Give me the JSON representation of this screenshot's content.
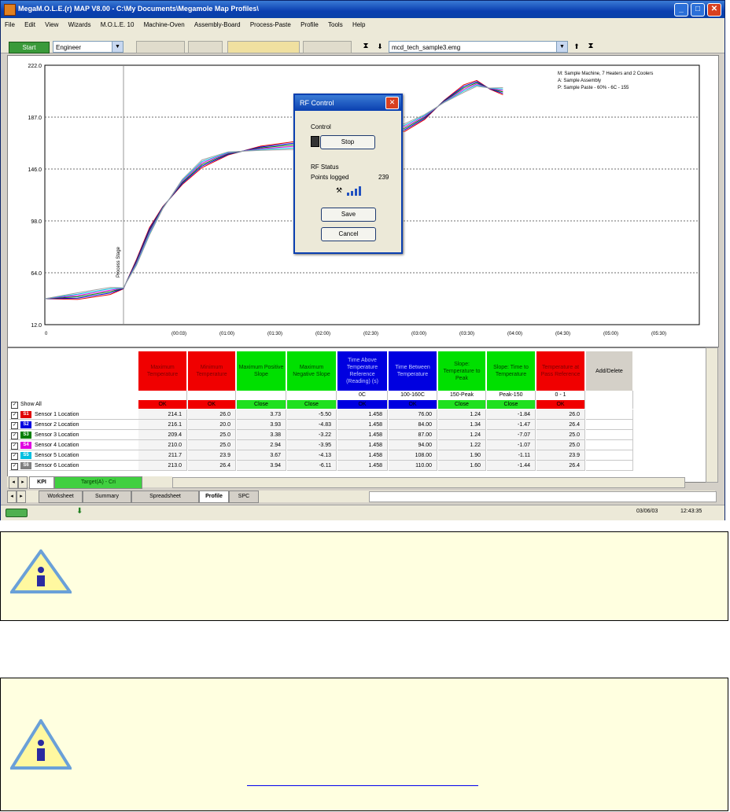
{
  "window": {
    "title": "MegaM.O.L.E.(r) MAP V8.00 - C:\\My Documents\\Megamole Map Profiles\\",
    "minimize": "_",
    "maximize": "□",
    "close": "✕"
  },
  "menu": [
    "File",
    "Edit",
    "View",
    "Wizards",
    "M.O.L.E. 10",
    "Machine-Oven",
    "Assembly-Board",
    "Process-Paste",
    "Profile",
    "Tools",
    "Help"
  ],
  "toolbar": {
    "start_label": "Start",
    "user_combo": "Engineer",
    "file_combo": "mcd_tech_sample3.emg"
  },
  "chart": {
    "y_ticks": [
      "222.0",
      "187.0",
      "146.0",
      "98.0",
      "64.0",
      "12.0"
    ],
    "x_ticks": [
      "0",
      "(00:03)",
      "(01:00)",
      "(01:30)",
      "(02:00)",
      "(02:30)",
      "(03:00)",
      "(03:30)",
      "(04:00)",
      "(04:30)",
      "(05:00)",
      "(05:30)"
    ],
    "legend": [
      "M: Sample Machine, 7 Heaters and 2 Coolers",
      "A: Sample Assembly",
      "P: Sample Paste - 60% - 6C - 155"
    ],
    "annotation": "Process Stage"
  },
  "rf_dialog": {
    "title": "RF Control",
    "close": "✕",
    "control_label": "Control",
    "stop_button": "Stop",
    "status_label": "RF Status",
    "points_logged_label": "Points logged",
    "points_logged_value": "239",
    "save_button": "Save",
    "cancel_button": "Cancel"
  },
  "grid": {
    "show_all": "Show All",
    "columns": [
      {
        "label": "Maximum Temperature",
        "color": "red",
        "spec": "",
        "status": "OK"
      },
      {
        "label": "Minimum Temperature",
        "color": "red",
        "spec": "",
        "status": "OK"
      },
      {
        "label": "Maximum Positive Slope",
        "color": "green",
        "spec": "",
        "status": "Close"
      },
      {
        "label": "Maximum Negative Slope",
        "color": "green",
        "spec": "",
        "status": "Close"
      },
      {
        "label": "Time Above Temperature Reference (Reading) (s)",
        "color": "blue",
        "spec": "0C",
        "status": "OK"
      },
      {
        "label": "Time Between Temperature",
        "color": "blue",
        "spec": "100-160C",
        "status": "OK"
      },
      {
        "label": "Slope: Temperature to Peak",
        "color": "green",
        "spec": "150-Peak",
        "status": "Close"
      },
      {
        "label": "Slope: Time to Temperature",
        "color": "green",
        "spec": "Peak-150",
        "status": "Close"
      },
      {
        "label": "Temperature at Pass Reference",
        "color": "red",
        "spec": "0 - 1",
        "status": "OK"
      },
      {
        "label": "Add/Delete",
        "color": "gray",
        "spec": "",
        "status": ""
      }
    ],
    "rows": [
      {
        "badge": "S1",
        "badge_color": "#e00000",
        "label": "Sensor 1 Location",
        "values": [
          "214.1",
          "26.0",
          "3.73",
          "-5.50",
          "1.458",
          "76.00",
          "1.24",
          "-1.84",
          "26.0"
        ]
      },
      {
        "badge": "S2",
        "badge_color": "#0000e0",
        "label": "Sensor 2 Location",
        "values": [
          "216.1",
          "20.0",
          "3.93",
          "-4.83",
          "1.458",
          "84.00",
          "1.34",
          "-1.47",
          "26.4"
        ]
      },
      {
        "badge": "S3",
        "badge_color": "#008000",
        "label": "Sensor 3 Location",
        "values": [
          "209.4",
          "25.0",
          "3.38",
          "-3.22",
          "1.458",
          "87.00",
          "1.24",
          "-7.07",
          "25.0"
        ]
      },
      {
        "badge": "S4",
        "badge_color": "#e000e0",
        "label": "Sensor 4 Location",
        "values": [
          "210.0",
          "25.0",
          "2.94",
          "-3.95",
          "1.458",
          "94.00",
          "1.22",
          "-1.07",
          "25.0"
        ]
      },
      {
        "badge": "S5",
        "badge_color": "#00c0e0",
        "label": "Sensor 5 Location",
        "values": [
          "211.7",
          "23.9",
          "3.67",
          "-4.13",
          "1.458",
          "108.00",
          "1.90",
          "-1.11",
          "23.9"
        ]
      },
      {
        "badge": "S6",
        "badge_color": "#808080",
        "label": "Sensor 6 Location",
        "values": [
          "213.0",
          "26.4",
          "3.94",
          "-6.11",
          "1.458",
          "110.00",
          "1.60",
          "-1.44",
          "26.4"
        ]
      }
    ]
  },
  "sheet_tabs": [
    "KPI",
    "Target(A) - Cri"
  ],
  "bottom_tabs": [
    "Worksheet",
    "Summary",
    "Spreadsheet",
    "Profile",
    "SPC"
  ],
  "status": {
    "date": "03/06/03",
    "time": "12:43:35"
  },
  "notes": [
    {
      "text": "",
      "link": ""
    },
    {
      "text": "",
      "link": "________________________________"
    }
  ]
}
